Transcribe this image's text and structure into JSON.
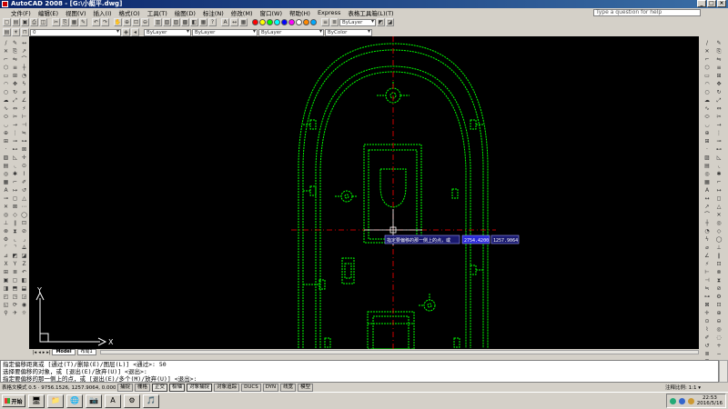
{
  "window": {
    "title": "AutoCAD 2008 - [G:\\小艇平.dwg]"
  },
  "menu": [
    "文件(F)",
    "编辑(E)",
    "视图(V)",
    "插入(I)",
    "格式(O)",
    "工具(T)",
    "绘图(D)",
    "标注(N)",
    "修改(M)",
    "窗口(W)",
    "帮助(H)",
    "Express",
    "表格工具箱(L)(T)"
  ],
  "help_search": {
    "placeholder": "Type a question for help"
  },
  "layer_combos": {
    "layer": "0",
    "color": "ByLayer",
    "linetype": "ByLayer",
    "lineweight": "ByLayer",
    "plotstyle": "ByColor"
  },
  "palette_colors": [
    "#ff0000",
    "#ffff00",
    "#00ff00",
    "#00ffff",
    "#0000ff",
    "#ff00ff",
    "#ffffff",
    "#ff8800",
    "#00aaff"
  ],
  "canvas": {
    "drawing_color": "#00ff00",
    "centerline_color": "#ff0000",
    "tooltip_prompt": "指定要偏移的那一侧上的点，或",
    "tooltip_value1": "2754.4200",
    "tooltip_value2": "1257.9064"
  },
  "tabs": {
    "model": "Model",
    "layout": "布局1"
  },
  "command_lines": [
    "指定偏移距离或 [通过(T)/删除(E)/图层(L)] <通过>:  50",
    "选择要偏移的对象，或 [退出(E)/放弃(U)] <退出>:",
    "指定要偏移的那一侧上的点，或 [退出(E)/多个(M)/放弃(U)] <退出>:"
  ],
  "status": {
    "coords": "表格文模式 0.5 · 9756.1526, 1257.9064, 0.0000",
    "buttons": [
      "捕捉",
      "栅格",
      "正交",
      "极轴",
      "对象捕捉",
      "对象追踪",
      "DUCS",
      "DYN",
      "线宽",
      "模型"
    ],
    "on_buttons": [
      "正交",
      "极轴",
      "对象捕捉"
    ],
    "annotation_scale": "注释比例: 1:1 ▾"
  },
  "taskbar": {
    "start_label": "开始",
    "apps": [
      "🖥",
      "📁",
      "🌐",
      "📷",
      "A",
      "⚙",
      "🎵"
    ],
    "clock_time": "22:53",
    "clock_date": "2016/5/16"
  }
}
